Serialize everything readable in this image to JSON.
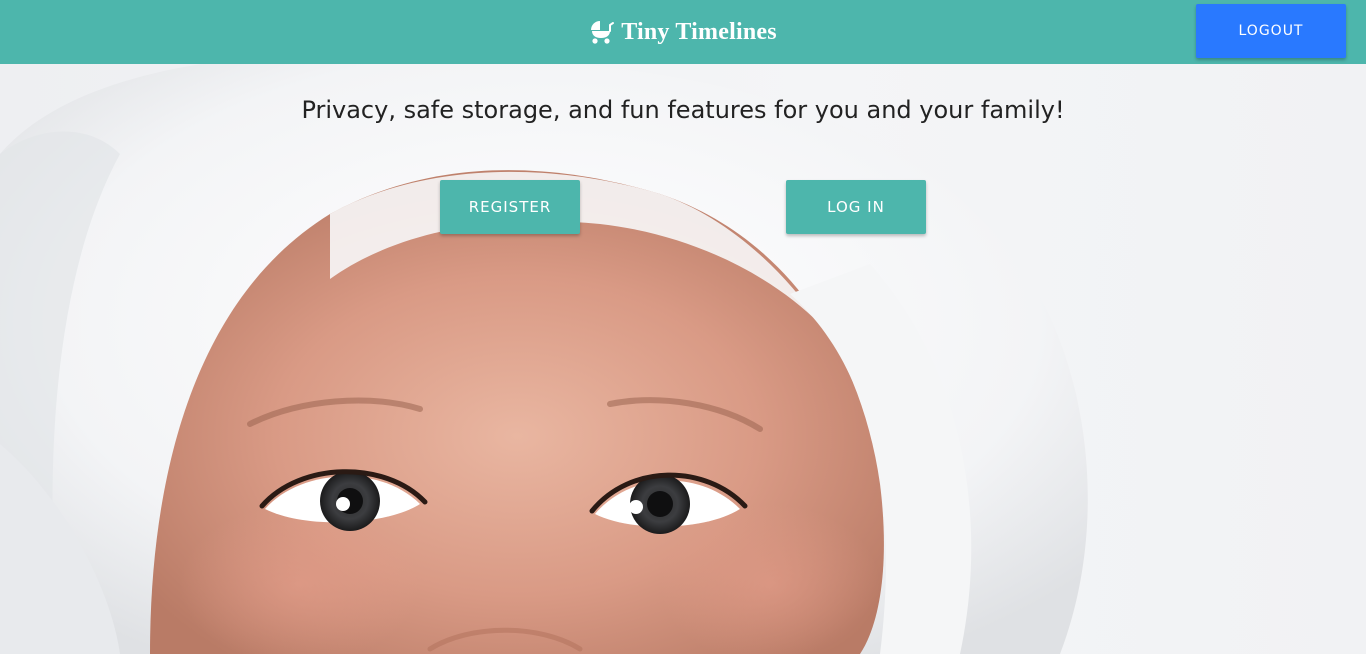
{
  "navbar": {
    "brand_icon": "baby-carriage-icon",
    "brand_title": "Tiny Timelines",
    "logout_label": "LOGOUT",
    "background_color": "#4db6ac",
    "logout_color": "#2979ff"
  },
  "hero": {
    "tagline": "Privacy, safe storage, and fun features for you and your family!",
    "register_label": "REGISTER",
    "login_label": "LOG IN",
    "button_color": "#4db6ac"
  }
}
